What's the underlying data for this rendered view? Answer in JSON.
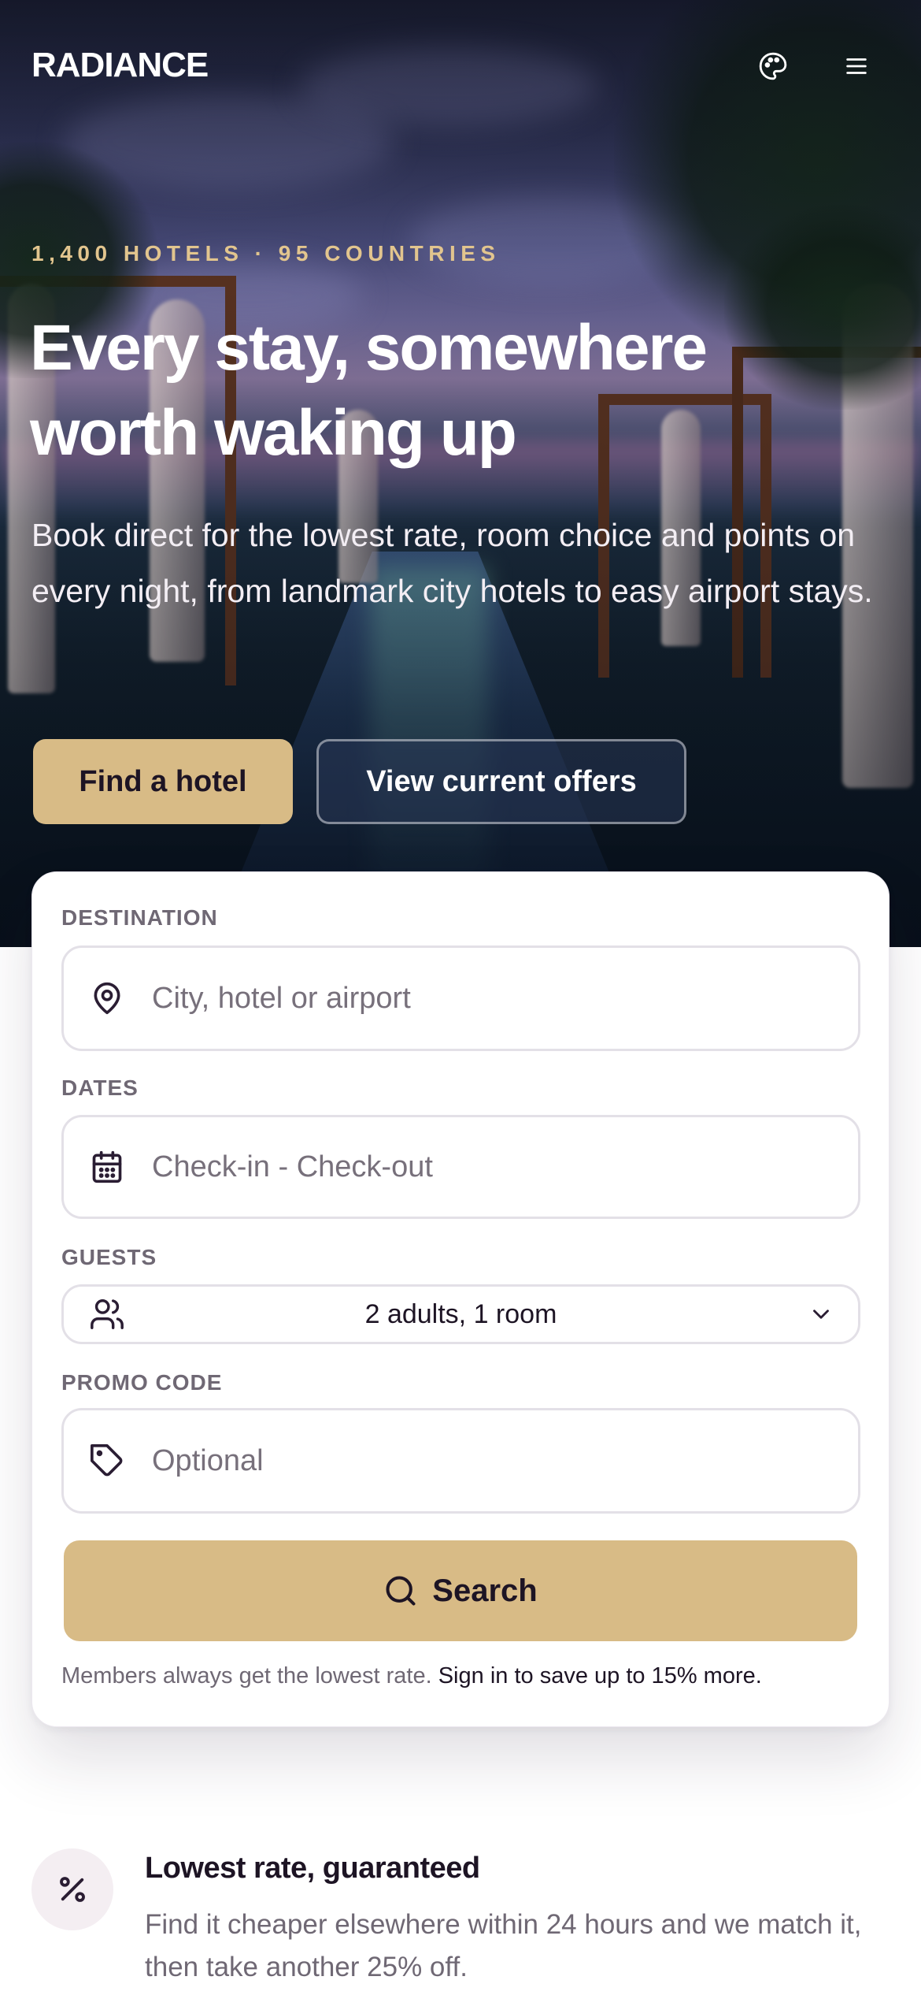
{
  "header": {
    "brand": "RADIANCE",
    "theme_icon": "palette-icon",
    "menu_icon": "hamburger-menu-icon"
  },
  "hero": {
    "eyebrow": "1,400 HOTELS · 95 COUNTRIES",
    "headline_line1": "Every stay, somewhere",
    "headline_line2": "worth waking up",
    "lede": "Book direct for the lowest rate, room choice and points on every night, from landmark city hotels to easy airport stays.",
    "primary_button": "Find a hotel",
    "secondary_button": "View current offers"
  },
  "booking": {
    "destination": {
      "label": "DESTINATION",
      "placeholder": "City, hotel or airport",
      "icon": "map-pin-icon"
    },
    "dates": {
      "label": "DATES",
      "placeholder": "Check-in - Check-out",
      "icon": "calendar-icon"
    },
    "guests": {
      "label": "GUESTS",
      "value": "2 adults, 1 room",
      "icon": "users-icon"
    },
    "promo": {
      "label": "PROMO CODE",
      "placeholder": "Optional",
      "icon": "tag-icon"
    },
    "search_button": "Search",
    "note_text": "Members always get the lowest rate.",
    "note_link": "Sign in to save up to 15% more."
  },
  "feature": {
    "icon": "percent-icon",
    "title": "Lowest rate, guaranteed",
    "text": "Find it cheaper elsewhere within 24 hours and we match it, then take another 25% off."
  },
  "colors": {
    "accent_gold": "#d8bb86",
    "eyebrow_gold": "#e2c58e",
    "ink": "#1d1424",
    "muted": "#6f6874"
  }
}
